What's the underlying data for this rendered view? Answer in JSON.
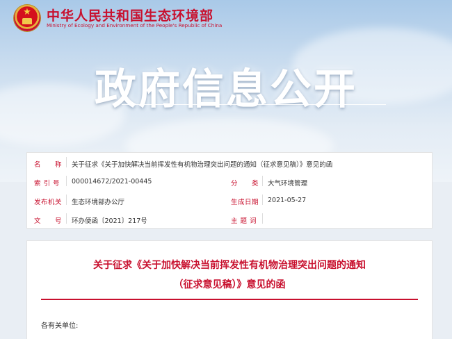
{
  "header": {
    "ministry_cn": "中华人民共和国生态环境部",
    "ministry_en": "Ministry of Ecology and Environment of the People's Republic of China",
    "banner_title": "政府信息公开"
  },
  "info_table": {
    "name_label": "名　　称",
    "name_value": "关于征求《关于加快解决当前挥发性有机物治理突出问题的通知（征求意见稿）》意见的函",
    "index_label": "索 引 号",
    "index_value": "000014672/2021-00445",
    "category_label": "分　　类",
    "category_value": "大气环境管理",
    "issuer_label": "发布机关",
    "issuer_value": "生态环境部办公厅",
    "date_label": "生成日期",
    "date_value": "2021-05-27",
    "docno_label": "文　　号",
    "docno_value": "环办便函〔2021〕217号",
    "subject_label": "主 题 词",
    "subject_value": ""
  },
  "article": {
    "title_line1": "关于征求《关于加快解决当前挥发性有机物治理突出问题的通知",
    "title_line2": "（征求意见稿）》意见的函",
    "salutation": "各有关单位:"
  },
  "colors": {
    "accent_red": "#c8102e",
    "banner_sky": "#a9c9e8"
  }
}
